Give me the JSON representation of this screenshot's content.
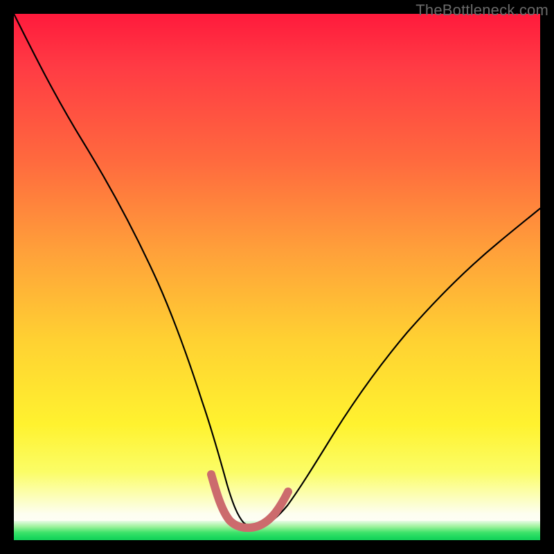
{
  "watermark": {
    "text": "TheBottleneck.com"
  },
  "colors": {
    "background": "#000000",
    "curve_stroke": "#000000",
    "valley_stroke": "#cc6b6d",
    "gradient_top": "#ff1a3c",
    "gradient_bottom_green": "#12cf57"
  },
  "chart_data": {
    "type": "line",
    "title": "",
    "xlabel": "",
    "ylabel": "",
    "xlim": [
      0,
      100
    ],
    "ylim": [
      0,
      100
    ],
    "grid": false,
    "legend": false,
    "series": [
      {
        "name": "bottleneck-curve",
        "x": [
          0,
          5,
          10,
          15,
          20,
          25,
          30,
          33,
          35,
          37,
          39,
          41,
          43,
          46,
          50,
          55,
          60,
          65,
          70,
          75,
          80,
          85,
          90,
          95,
          100
        ],
        "values": [
          100,
          90,
          80,
          70,
          60,
          49,
          37,
          28,
          20,
          13,
          7,
          4,
          3,
          3,
          4,
          7,
          12,
          18,
          25,
          32,
          39,
          46,
          52,
          58,
          63
        ]
      },
      {
        "name": "valley-highlight",
        "x": [
          37,
          39,
          41,
          43,
          46,
          49
        ],
        "values": [
          13,
          7,
          4,
          3,
          3,
          6
        ]
      }
    ],
    "annotations": [
      {
        "text": "TheBottleneck.com",
        "position": "top-right"
      }
    ]
  }
}
